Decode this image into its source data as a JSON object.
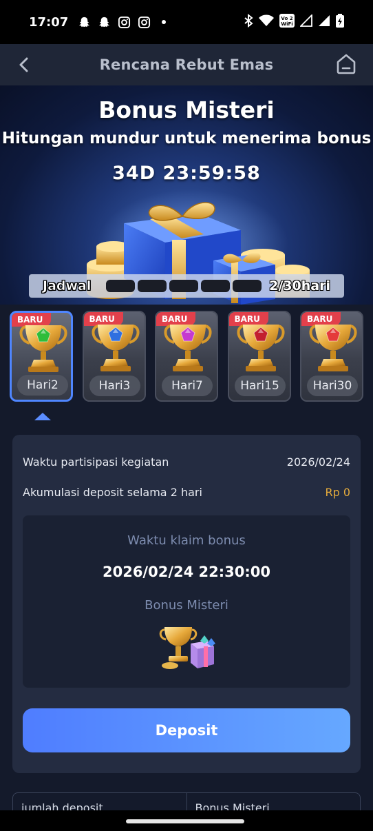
{
  "status_bar": {
    "time": "17:07",
    "left_icons": [
      "snapchat-icon",
      "snapchat-icon",
      "instagram-icon",
      "instagram-icon"
    ],
    "right_icons": [
      "bluetooth-icon",
      "wifi-icon",
      "vowifi-icon",
      "signal-icon",
      "signal-icon",
      "battery-icon"
    ],
    "vowifi_label": "Vo WiFi 2"
  },
  "header": {
    "title": "Rencana Rebut Emas",
    "back_icon": "chevron-left-icon",
    "home_icon": "home-icon"
  },
  "hero": {
    "title": "Bonus Misteri",
    "subtitle": "Hitungan mundur untuk menerima bonus",
    "countdown": "34D 23:59:58",
    "schedule_label": "Jadwal",
    "schedule_progress": "2/30hari",
    "schedule_segments": 5,
    "schedule_filled": 5
  },
  "days": [
    {
      "label": "Hari2",
      "badge": "BARU",
      "gem_color": "#2fbd3a",
      "active": true
    },
    {
      "label": "Hari3",
      "badge": "BARU",
      "gem_color": "#2f6fe0",
      "active": false
    },
    {
      "label": "Hari7",
      "badge": "BARU",
      "gem_color": "#c53ad0",
      "active": false
    },
    {
      "label": "Hari15",
      "badge": "BARU",
      "gem_color": "#c2202f",
      "active": false
    },
    {
      "label": "Hari30",
      "badge": "BARU",
      "gem_color": "#e43a3a",
      "active": false
    }
  ],
  "info": {
    "participation_label": "Waktu partisipasi kegiatan",
    "participation_value": "2026/02/24",
    "accumulation_label": "Akumulasi deposit selama 2 hari",
    "accumulation_value": "Rp 0",
    "claim_label": "Waktu klaim bonus",
    "claim_time": "2026/02/24 22:30:00",
    "bonus_label": "Bonus Misteri",
    "deposit_button": "Deposit"
  },
  "table": {
    "col1": "jumlah deposit",
    "col2": "Bonus Misteri"
  },
  "colors": {
    "accent": "#4f7dff",
    "badge": "#e2404b",
    "money": "#e6ac3c"
  }
}
